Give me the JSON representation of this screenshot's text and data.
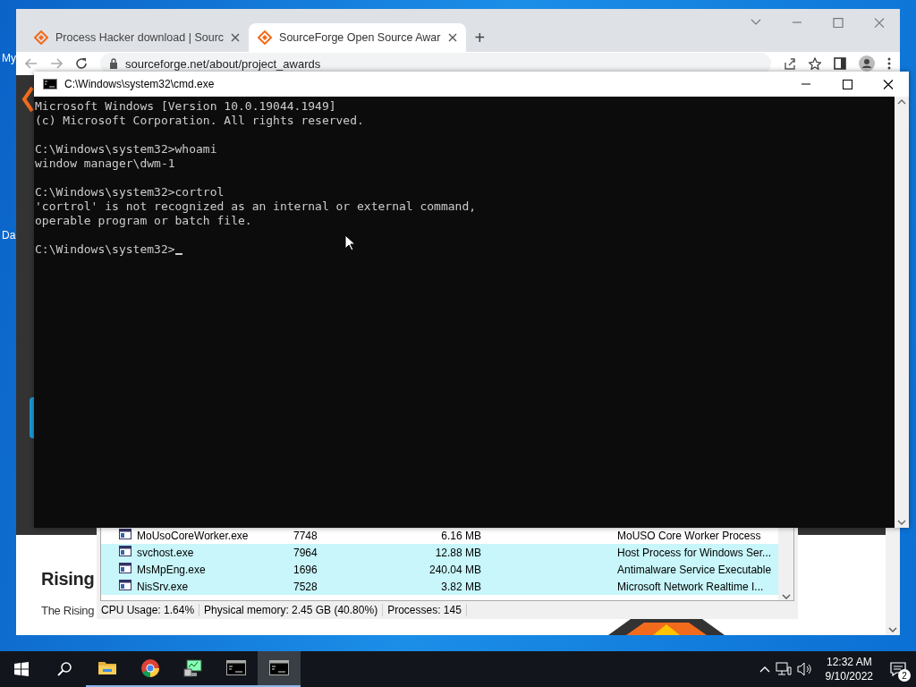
{
  "desktop": {
    "icon_labels": [
      "My",
      "Da"
    ]
  },
  "browser": {
    "tabs": [
      {
        "title": "Process Hacker download | Sourc",
        "selected": false
      },
      {
        "title": "SourceForge Open Source Awar",
        "selected": true
      }
    ],
    "new_tab": "+",
    "address": "sourceforge.net/about/project_awards",
    "page": {
      "heading": "Rising",
      "text": "The Rising"
    }
  },
  "cmd": {
    "title": "C:\\Windows\\system32\\cmd.exe",
    "blocks": [
      [
        "Microsoft Windows [Version 10.0.19044.1949]",
        "(c) Microsoft Corporation. All rights reserved."
      ],
      [
        "C:\\Windows\\system32>whoami",
        "window manager\\dwm-1"
      ],
      [
        "C:\\Windows\\system32>cortrol",
        "'cortrol' is not recognized as an internal or external command,",
        "operable program or batch file."
      ]
    ],
    "prompt": "C:\\Windows\\system32>"
  },
  "process_hacker": {
    "rows": [
      {
        "name": "MoUsoCoreWorker.exe",
        "pid": "7748",
        "memory": "6.16 MB",
        "description": "MoUSO Core Worker Process",
        "color": "#ffffff"
      },
      {
        "name": "svchost.exe",
        "pid": "7964",
        "memory": "12.88 MB",
        "description": "Host Process for Windows Ser...",
        "color": "#c8f6fa"
      },
      {
        "name": "MsMpEng.exe",
        "pid": "1696",
        "memory": "240.04 MB",
        "description": "Antimalware Service Executable",
        "color": "#c8f6fa"
      },
      {
        "name": "NisSrv.exe",
        "pid": "7528",
        "memory": "3.82 MB",
        "description": "Microsoft Network Realtime I...",
        "color": "#c8f6fa"
      }
    ],
    "status": [
      "CPU Usage: 1.64%",
      "Physical memory: 2.45 GB (40.80%)",
      "Processes: 145"
    ]
  },
  "taskbar": {
    "apps": [
      {
        "kind": "folder",
        "active": false
      },
      {
        "kind": "chrome",
        "active": false
      },
      {
        "kind": "monitor",
        "active": false
      },
      {
        "kind": "console",
        "active": false
      },
      {
        "kind": "console",
        "active": true
      }
    ],
    "time": "12:32 AM",
    "date": "9/10/2022",
    "notifications": "2"
  }
}
